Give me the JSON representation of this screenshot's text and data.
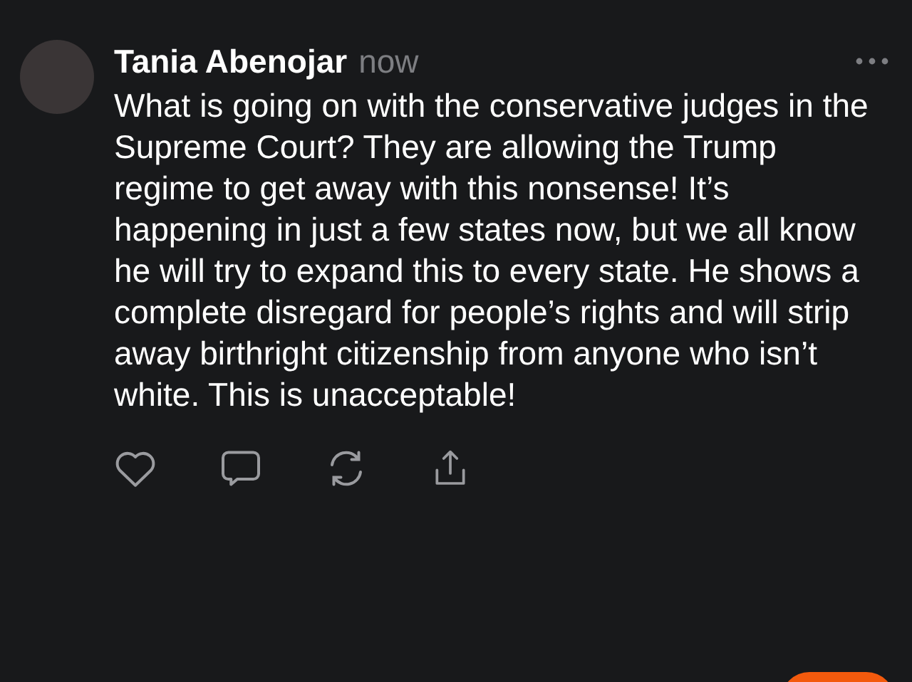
{
  "post": {
    "author": "Tania Abenojar",
    "time": "now",
    "text": "What is going on with the conservative judges in the Supreme Court? They are allowing the Trump regime to get away with this nonsense! It’s happening in just a few states now, but we all know he will try to expand this to every state. He shows a complete disregard for people’s rights and will strip away birthright citizenship from anyone who isn’t white. This is unacceptable!"
  }
}
